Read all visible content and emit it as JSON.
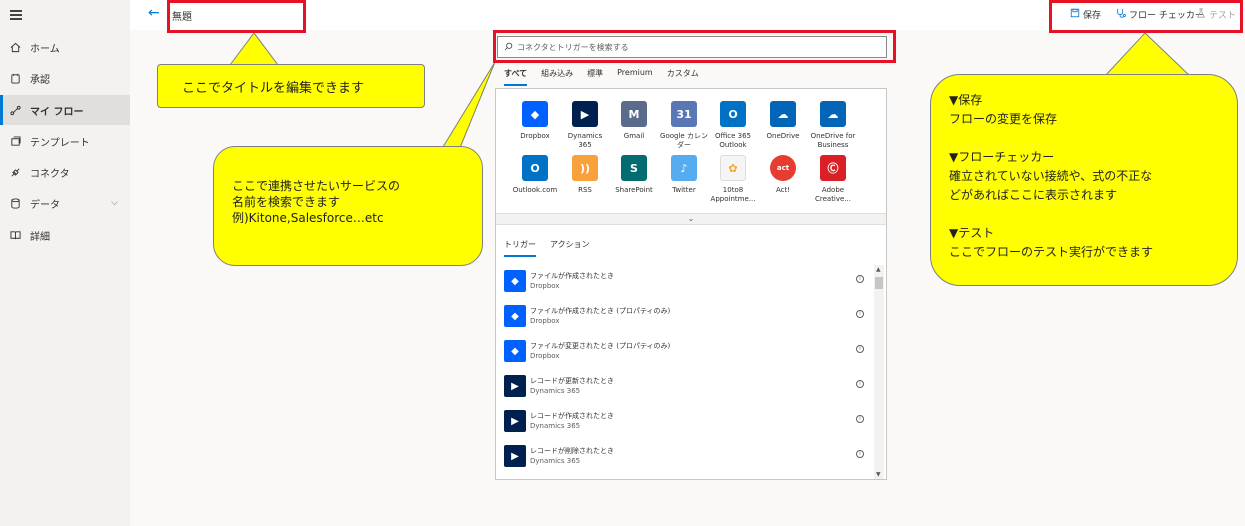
{
  "topbar": {
    "title": "無題",
    "save_label": "保存",
    "checker_label": "フロー チェッカー",
    "test_label": "テスト"
  },
  "sidebar": {
    "items": [
      {
        "label": "ホーム",
        "icon": "home-icon"
      },
      {
        "label": "承認",
        "icon": "approval-icon"
      },
      {
        "label": "マイ フロー",
        "icon": "flow-icon"
      },
      {
        "label": "テンプレート",
        "icon": "template-icon"
      },
      {
        "label": "コネクタ",
        "icon": "connector-icon"
      },
      {
        "label": "データ",
        "icon": "database-icon"
      },
      {
        "label": "詳細",
        "icon": "book-icon"
      }
    ],
    "active": "マイ フロー"
  },
  "search": {
    "placeholder": "コネクタとトリガーを検索する"
  },
  "connector_tabs": [
    "すべて",
    "組み込み",
    "標準",
    "Premium",
    "カスタム"
  ],
  "connectors": [
    {
      "name": "Dropbox",
      "color": "#0061fe",
      "glyph": "◆"
    },
    {
      "name": "Dynamics 365",
      "color": "#002050",
      "glyph": "▶"
    },
    {
      "name": "Gmail",
      "color": "#5b6b8c",
      "glyph": "M"
    },
    {
      "name": "Google カレンダー",
      "color": "#5976b5",
      "glyph": "31"
    },
    {
      "name": "Office 365 Outlook",
      "color": "#0072c6",
      "glyph": "O"
    },
    {
      "name": "OneDrive",
      "color": "#0364b8",
      "glyph": "☁"
    },
    {
      "name": "OneDrive for Business",
      "color": "#0364b8",
      "glyph": "☁"
    },
    {
      "name": "Outlook.com",
      "color": "#0072c6",
      "glyph": "O"
    },
    {
      "name": "RSS",
      "color": "#f7a03c",
      "glyph": "))"
    },
    {
      "name": "SharePoint",
      "color": "#036c70",
      "glyph": "S"
    },
    {
      "name": "Twitter",
      "color": "#55acee",
      "glyph": "♪"
    },
    {
      "name": "10to8 Appointme...",
      "color": "#f5f5f5",
      "glyph": "✿"
    },
    {
      "name": "Act!",
      "color": "#e53d2f",
      "glyph": "act"
    },
    {
      "name": "Adobe Creative...",
      "color": "#da1f26",
      "glyph": "Ⓒ"
    }
  ],
  "expand_glyph": "⌄",
  "trigger_tabs": [
    "トリガー",
    "アクション"
  ],
  "triggers": [
    {
      "name": "ファイルが作成されたとき",
      "service": "Dropbox",
      "color": "#0061fe",
      "glyph": "◆"
    },
    {
      "name": "ファイルが作成されたとき (プロパティのみ)",
      "service": "Dropbox",
      "color": "#0061fe",
      "glyph": "◆"
    },
    {
      "name": "ファイルが変更されたとき (プロパティのみ)",
      "service": "Dropbox",
      "color": "#0061fe",
      "glyph": "◆"
    },
    {
      "name": "レコードが更新されたとき",
      "service": "Dynamics 365",
      "color": "#002050",
      "glyph": "▶"
    },
    {
      "name": "レコードが作成されたとき",
      "service": "Dynamics 365",
      "color": "#002050",
      "glyph": "▶"
    },
    {
      "name": "レコードが削除されたとき",
      "service": "Dynamics 365",
      "color": "#002050",
      "glyph": "▶"
    },
    {
      "name": "",
      "service": "",
      "color": "#002050",
      "glyph": "▶"
    }
  ],
  "callouts": {
    "title": "ここでタイトルを編集できます",
    "search": "ここで連携させたいサービスの\n名前を検索できます\n例)Kitone,Salesforce…etc",
    "toolbar": "▼保存\nフローの変更を保存\n\n▼フローチェッカー\n確立されていない接続や、式の不正な\nどがあればここに表示されます\n\n▼テスト\nここでフローのテスト実行ができます"
  },
  "colors": {
    "accent": "#0078d4",
    "annotation_red": "#e81123",
    "callout_yellow": "#ffff00"
  }
}
